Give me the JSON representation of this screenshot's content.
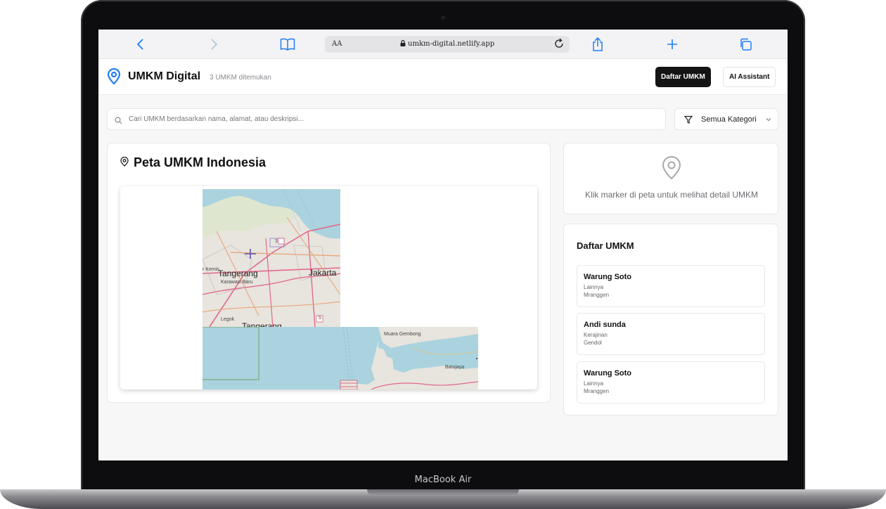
{
  "device": {
    "label": "MacBook Air"
  },
  "browser": {
    "text_size_label": "AA",
    "url": "umkm-digital.netlify.app",
    "icons": [
      "back-icon",
      "forward-icon",
      "bookmarks-icon",
      "lock-icon",
      "reload-icon",
      "share-icon",
      "new-tab-icon",
      "tabs-icon"
    ]
  },
  "header": {
    "title": "UMKM Digital",
    "count_text": "3 UMKM ditemukan",
    "nav_list_label": "Daftar UMKM",
    "nav_ai_label": "AI Assistant"
  },
  "search": {
    "placeholder": "Cari UMKM berdasarkan nama, alamat, atau deskripsi...",
    "value": "",
    "category_selected": "Semua Kategori"
  },
  "map": {
    "title": "Peta UMKM Indonesia",
    "labels": {
      "tangerang": "Tangerang",
      "jakarta": "Jakarta",
      "karawaci": "Karawaci Baru",
      "kemis": "r Kemis",
      "legok": "Legok",
      "tangerang_south": "Tangerang",
      "muara": "Muara Gembong",
      "batujaya": "Batujaya",
      "road_3": "3",
      "road_5": "5"
    }
  },
  "detail": {
    "hint": "Klik marker di peta untuk melihat detail UMKM"
  },
  "umkm_list": {
    "title": "Daftar UMKM",
    "items": [
      {
        "name": "Warung Soto",
        "category": "Lainnya",
        "location": "Mranggen"
      },
      {
        "name": "Andi sunda",
        "category": "Kerajinan",
        "location": "Gendol"
      },
      {
        "name": "Warung Soto",
        "category": "Lainnya",
        "location": "Mranggen"
      }
    ]
  },
  "colors": {
    "accent": "#1f7cf5",
    "brand_dark": "#141414",
    "map_water": "#aad3df",
    "map_land": "#e8e4de",
    "map_road": "#e06a8a"
  }
}
